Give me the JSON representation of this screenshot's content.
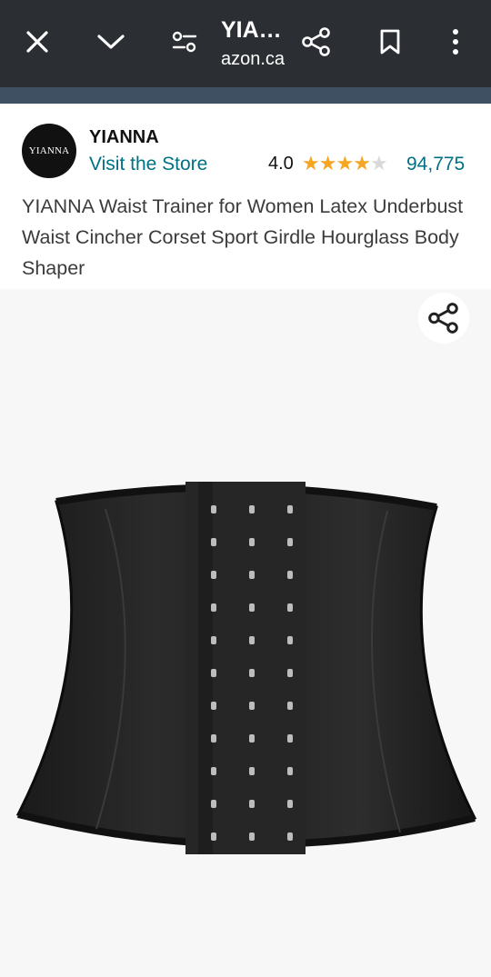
{
  "browser": {
    "title": "YIA…",
    "domain": "azon.ca",
    "icons": [
      "close-icon",
      "chevron-down-icon",
      "page-filter-icon",
      "share-icon",
      "bookmark-icon",
      "more-vert-icon"
    ]
  },
  "product": {
    "brand_logo_text": "YIANNA",
    "brand": "YIANNA",
    "store_link": "Visit the Store",
    "rating": "4.0",
    "rating_value": 4.0,
    "rating_max": 5,
    "review_count": "94,775",
    "title": "YIANNA Waist Trainer for Women Latex Underbust Waist Cincher Corset Sport Girdle Hourglass Body Shaper"
  },
  "colors": {
    "topbar": "#2b2f33",
    "link": "#007185",
    "star": "#f5a623"
  }
}
